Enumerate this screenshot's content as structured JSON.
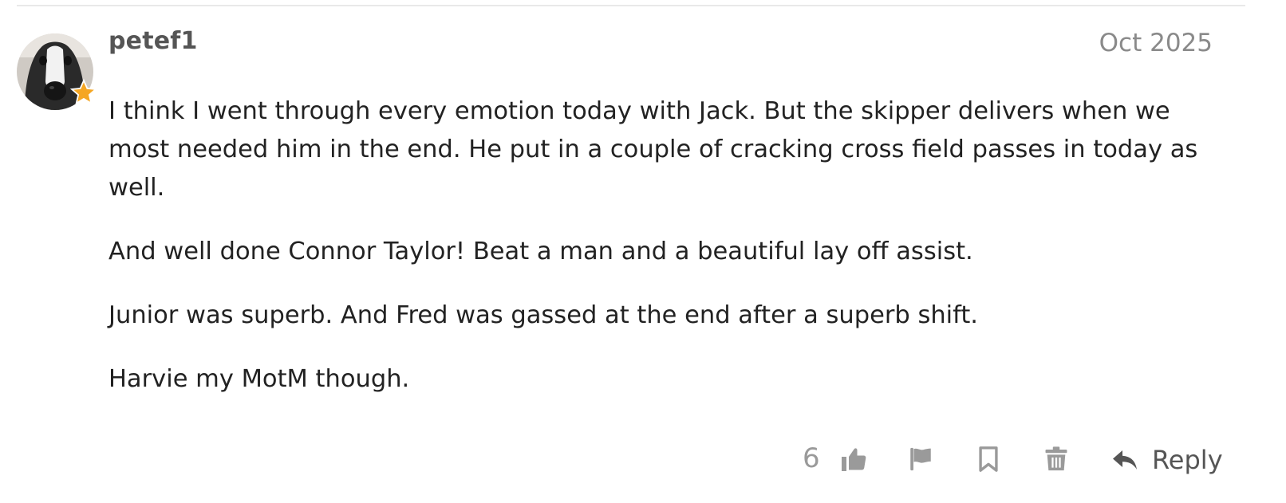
{
  "post": {
    "username": "petef1",
    "date": "Oct 2025",
    "avatar": {
      "icon": "greyhound-avatar",
      "badge_icon": "star-icon",
      "badge_color": "#f5a623"
    },
    "paragraphs": [
      "I think I went through every emotion today with Jack. But the skipper delivers when we most needed him in the end. He put in a couple of cracking cross field passes in today as well.",
      "And well done Connor Taylor! Beat a man and a beautiful lay off assist.",
      "Junior was superb. And Fred was gassed at the end after a superb shift.",
      "Harvie my MotM though."
    ]
  },
  "actions": {
    "like_count": "6",
    "like_icon": "thumbs-up-icon",
    "flag_icon": "flag-icon",
    "bookmark_icon": "bookmark-icon",
    "delete_icon": "trash-icon",
    "reply_icon": "reply-arrow-icon",
    "reply_label": "Reply",
    "icon_color": "#9a9a9a"
  }
}
